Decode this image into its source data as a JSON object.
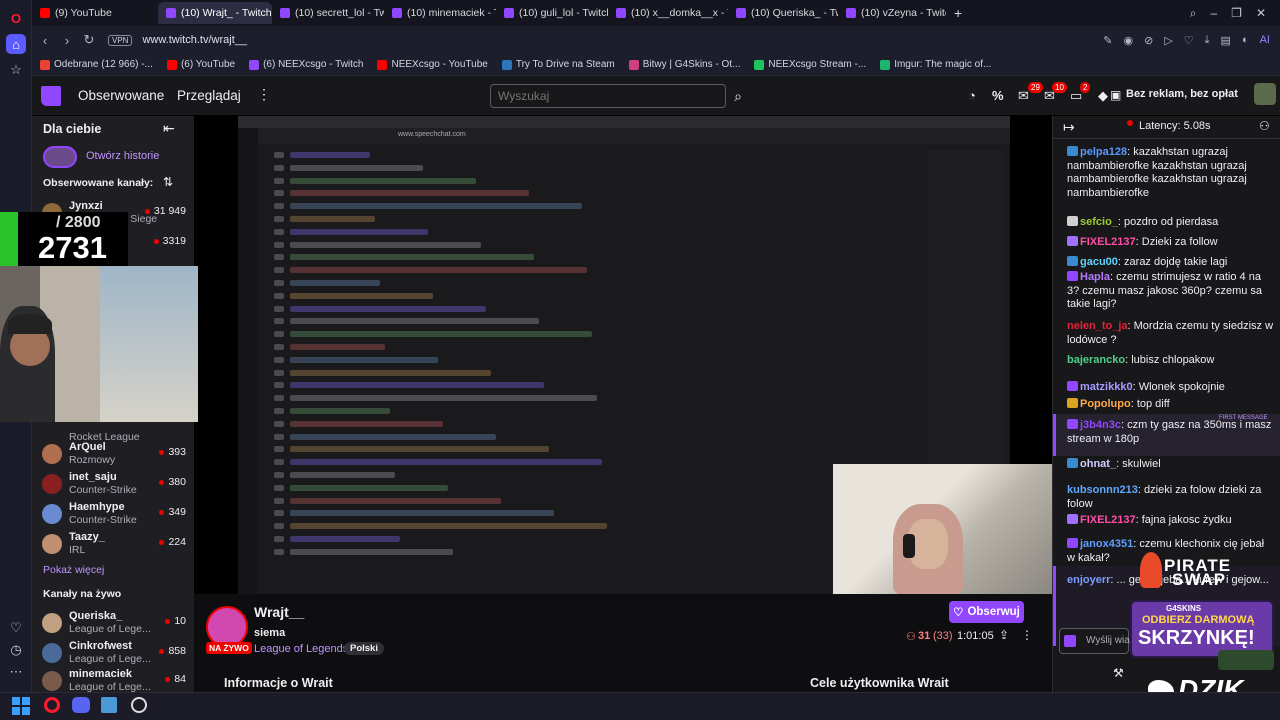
{
  "browser": {
    "tabs": [
      {
        "label": "(9) YouTube",
        "type": "yt"
      },
      {
        "label": "(10) Wrajt_ - Twitch",
        "type": "tw",
        "active": true
      },
      {
        "label": "(10) secrett_lol - Twitch",
        "type": "tw"
      },
      {
        "label": "(10) minemaciek - Twitch",
        "type": "tw"
      },
      {
        "label": "(10) guli_lol - Twitch",
        "type": "tw"
      },
      {
        "label": "(10) x__domka__x - Twitch",
        "type": "tw"
      },
      {
        "label": "(10) Queriska_ - Twitch",
        "type": "tw"
      },
      {
        "label": "(10) vZeyna - Twitch",
        "type": "tw"
      }
    ],
    "url": "www.twitch.tv/wrajt__",
    "vpn": "VPN",
    "bookmarks": [
      "Odebrane (12 966) -...",
      "(6) YouTube",
      "(6) NEEXcsgo - Twitch",
      "NEEXcsgo - YouTube",
      "Try To Drive na Steam",
      "Bitwy | G4Skins - Ot...",
      "NEEXcsgo Stream -...",
      "Imgur: The magic of..."
    ],
    "ai_label": "AI"
  },
  "twitch": {
    "nav": {
      "following": "Obserwowane",
      "browse": "Przeglądaj",
      "search_placeholder": "Wyszukaj",
      "ad_free": "Bez reklam, bez opłat",
      "badges": [
        "29",
        "10",
        "2"
      ]
    },
    "sidebar": {
      "for_you": "Dla ciebie",
      "open_stories": "Otwórz historie",
      "followed_channels": "Obserwowane kanały:",
      "channels": [
        {
          "name": "Jynxzi",
          "game": "Rainbow Six Siege",
          "viewers": "31 949",
          "color": "#8e6a3a"
        },
        {
          "name": "",
          "game": "",
          "viewers": "3319",
          "color": "#3a6e8e"
        },
        {
          "name": "",
          "game": "Rocket League",
          "viewers": "",
          "color": "#555"
        },
        {
          "name": "ArQuel",
          "game": "Rozmowy",
          "viewers": "393",
          "color": "#b07050"
        },
        {
          "name": "inet_saju",
          "game": "Counter-Strike",
          "viewers": "380",
          "color": "#8a2020"
        },
        {
          "name": "Haemhype",
          "game": "Counter-Strike",
          "viewers": "349",
          "color": "#6a8ad0"
        },
        {
          "name": "Taazy_",
          "game": "IRL",
          "viewers": "224",
          "color": "#c09070"
        }
      ],
      "show_more": "Pokaż więcej",
      "live_channels": "Kanały na żywo",
      "live": [
        {
          "name": "Queriska_",
          "game": "League of Lege...",
          "viewers": "10",
          "color": "#c0a080"
        },
        {
          "name": "Cinkrofwest",
          "game": "League of Lege...",
          "viewers": "858",
          "color": "#4a6a9a"
        },
        {
          "name": "minemaciek",
          "game": "League of Lege...",
          "viewers": "84",
          "color": "#7a5a4a"
        }
      ]
    },
    "overlay": {
      "goal": "/ 2800",
      "count": "2731"
    },
    "channel": {
      "name": "Wrajt__",
      "title": "siema",
      "live": "NA ŻYWO",
      "game": "League of Legends",
      "language": "Polski",
      "viewers": "31",
      "viewers_paren": "(33)",
      "uptime": "1:01:05",
      "follow": "Obserwuj",
      "about": "Informacje o Wrait",
      "goals": "Cele użytkownika Wrait"
    },
    "chat": {
      "latency": "Latency: 5.08s",
      "first_message": "FIRST MESSAGE",
      "input_placeholder": "Wyślij wiadomość",
      "messages": [
        {
          "user": "pelpa128",
          "color": "#5b99ff",
          "text": ": kazakhstan ugrazaj nambambierofke kazakhstan ugrazaj nambambierofke kazakhstan ugrazaj nambambierofke",
          "badge": "#3a8ad0"
        },
        {
          "user": "sefcio_",
          "color": "#9acd32",
          "text": ": pozdro od pierdasa",
          "badge": "#d0d0d0"
        },
        {
          "user": "FIXEL2137",
          "color": "#ff4fa8",
          "text": ": Dzieki za follow",
          "badge": "#a070ff"
        },
        {
          "user": "gacu00",
          "color": "#5fd4ff",
          "text": ": zaraz dojdę takie lagi",
          "badge": "#3a8ad0"
        },
        {
          "user": "Hapla",
          "color": "#b57aff",
          "text": ": czemu strimujesz w ratio 4 na 3? czemu masz jakosc 360p? czemu sa takie lagi?",
          "badge": "#9146ff"
        },
        {
          "user": "nelen_to_ja",
          "color": "#e0243a",
          "text": ": Mordzia czemu ty siedzisz w lodówce ?",
          "badge": ""
        },
        {
          "user": "bajerancko",
          "color": "#4fd08a",
          "text": ": lubisz chlopakow",
          "badge": ""
        },
        {
          "user": "matzikkk0",
          "color": "#a79bff",
          "text": ": Wlonek spokojnie",
          "badge": "#9146ff"
        },
        {
          "user": "Popolupo",
          "color": "#ffa84a",
          "text": ": top diff",
          "badge": "#d9a520"
        },
        {
          "user": "j3b4n3c",
          "color": "#9146ff",
          "text": ": czm ty gasz na 350ms i masz stream w 180p",
          "badge": "#9146ff"
        },
        {
          "user": "ohnat_",
          "color": "#d0d0ff",
          "text": ": skulwiel",
          "badge": "#3a8ad0"
        },
        {
          "user": "kubsonnn213",
          "color": "#5fa8ff",
          "text": ": dzieki za folow dzieki za folow",
          "badge": ""
        },
        {
          "user": "FIXEL2137",
          "color": "#ff4fa8",
          "text": ": fajna jakosc żydku",
          "badge": "#a070ff"
        },
        {
          "user": "janox4351",
          "color": "#5f9fff",
          "text": ": czemu klechonix cię jebał w kakał?",
          "badge": "#9146ff"
        },
        {
          "user": "enjoyerr",
          "color": "#7a9fff",
          "text": ": ... gejow jeba... kurew i gejow...",
          "badge": ""
        }
      ]
    },
    "promo": {
      "brand1": "PIRATE",
      "brand2": "SWAP",
      "g4": "G4SKINS",
      "line1": "ODBIERZ DARMOWĄ",
      "line2": "SKRZYNKĘ!",
      "dzik": "DZIK"
    }
  },
  "captured": {
    "url": "www.speechchat.com"
  }
}
